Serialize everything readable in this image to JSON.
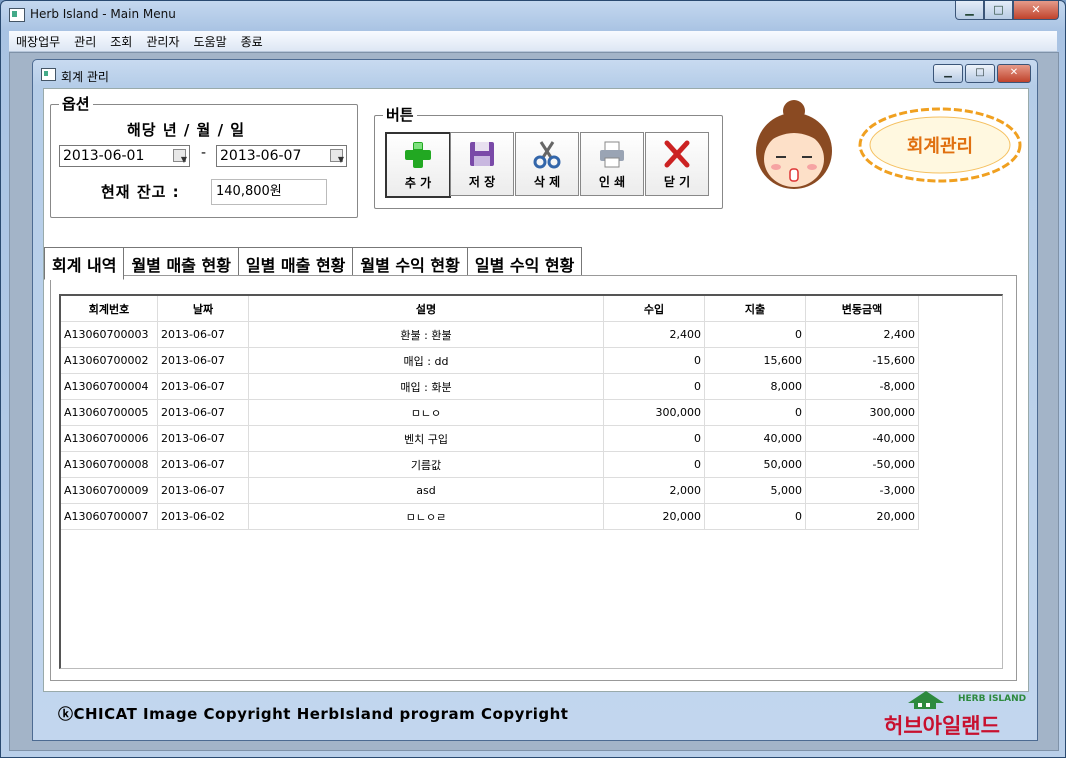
{
  "window": {
    "title": "Herb Island - Main Menu",
    "min": "▁",
    "max": "□",
    "close": "✕"
  },
  "menu": [
    "매장업무",
    "관리",
    "조회",
    "관리자",
    "도움말",
    "종료"
  ],
  "child": {
    "title": "회계 관리",
    "min": "▁",
    "max": "□",
    "close": "✕"
  },
  "options": {
    "label": "옵션",
    "date_heading": "해당 년 / 월 / 일",
    "date_from": "2013-06-01",
    "date_to": "2013-06-07",
    "dash": "-",
    "balance_label": "현재 잔고 :",
    "balance_value": "140,800원"
  },
  "buttons_group": {
    "label": "버튼",
    "add": "추 가",
    "save": "저 장",
    "delete": "삭 제",
    "print": "인 쇄",
    "close": "닫 기"
  },
  "banner_text": "회계관리",
  "tabs": [
    "회계 내역",
    "월별 매출 현황",
    "일별 매출 현황",
    "월별 수익 현황",
    "일별 수익 현황"
  ],
  "table": {
    "headers": [
      "회계번호",
      "날짜",
      "설명",
      "수입",
      "지출",
      "변동금액"
    ],
    "rows": [
      [
        "A13060700003",
        "2013-06-07",
        "환불 : 환불",
        "2,400",
        "0",
        "2,400"
      ],
      [
        "A13060700002",
        "2013-06-07",
        "매입 : dd",
        "0",
        "15,600",
        "-15,600"
      ],
      [
        "A13060700004",
        "2013-06-07",
        "매입 : 화분",
        "0",
        "8,000",
        "-8,000"
      ],
      [
        "A13060700005",
        "2013-06-07",
        "ㅁㄴㅇ",
        "300,000",
        "0",
        "300,000"
      ],
      [
        "A13060700006",
        "2013-06-07",
        "벤치 구입",
        "0",
        "40,000",
        "-40,000"
      ],
      [
        "A13060700008",
        "2013-06-07",
        "기름값",
        "0",
        "50,000",
        "-50,000"
      ],
      [
        "A13060700009",
        "2013-06-07",
        "asd",
        "2,000",
        "5,000",
        "-3,000"
      ],
      [
        "A13060700007",
        "2013-06-02",
        "ㅁㄴㅇㄹ",
        "20,000",
        "0",
        "20,000"
      ]
    ]
  },
  "copyright": "ⓚCHICAT Image Copyright HerbIsland program Copyright",
  "logo": {
    "en": "HERB ISLAND",
    "ko": "허브아일랜드"
  },
  "colors": {
    "add_icon": "#22a822",
    "save_icon": "#7a4aa8",
    "delete_icon": "#3366aa",
    "close_icon": "#cc2222",
    "logo_red": "#c8102e",
    "logo_green": "#2d8a3e",
    "banner_orange": "#f0a020"
  }
}
